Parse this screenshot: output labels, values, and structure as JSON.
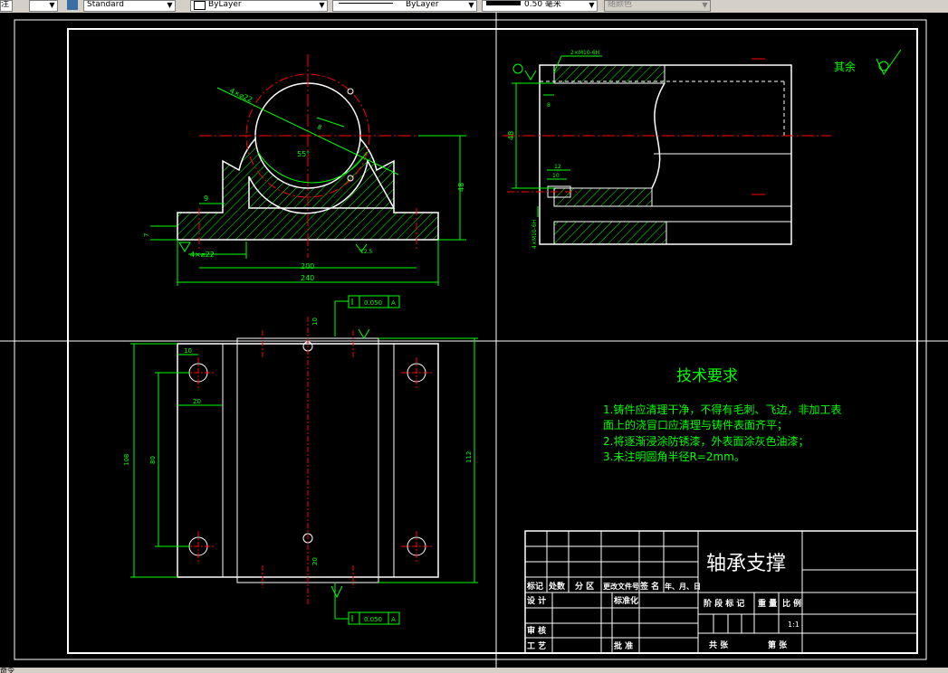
{
  "toolbar": {
    "cut_label": "注",
    "text_style": "Standard",
    "layer": "ByLayer",
    "linetype": "ByLayer",
    "lineweight": "0.50 毫米",
    "color": "随颜色"
  },
  "status": {
    "command_prefix": "命令"
  },
  "colors": {
    "green": "#00ff00",
    "red": "#ff0000",
    "white": "#ffffff",
    "background": "#000000"
  },
  "drawing": {
    "title": "技术要求",
    "requirements": [
      "1.铸件应清理干净，不得有毛刺、飞边，非加工表",
      "面上的浇冒口应清理与铸件表面齐平；",
      "2.将逐渐浸涂防锈漆，外表面涂灰色油漆；",
      "3.未注明圆角半径R=2mm。"
    ],
    "roughness_note": "其余",
    "dims": {
      "d_48": "48",
      "d_200": "200",
      "d_240": "240",
      "d_9": "9",
      "d_7": "7",
      "d_4x22": "4×⌀22",
      "d_55": "55°",
      "d_108": "108",
      "d_80": "80",
      "d_112": "112",
      "d_10": "10",
      "d_20": "20",
      "d_12": "12",
      "d_8": "8",
      "d_2xm10": "2×M10-6H",
      "d_4xm10": "4×M10-6H",
      "tol_top": "0.050",
      "tol_bottom": "0.050",
      "tol_datum": "A",
      "ra_val": "12.5"
    },
    "title_block": {
      "part_name": "轴承支撑",
      "h1": "标记",
      "h2": "处数",
      "h3": "分 区",
      "h4": "更改文件号",
      "h5": "签 名",
      "h6": "年、月、日",
      "design": "设 计",
      "standard": "标准化",
      "review": "审 核",
      "process": "工 艺",
      "approve": "批 准",
      "stage": "阶 段 标 记",
      "weight": "重 量",
      "scale": "比 例",
      "scale_val": "1:1",
      "sheets": "共   张",
      "sheet": "第   张"
    }
  }
}
